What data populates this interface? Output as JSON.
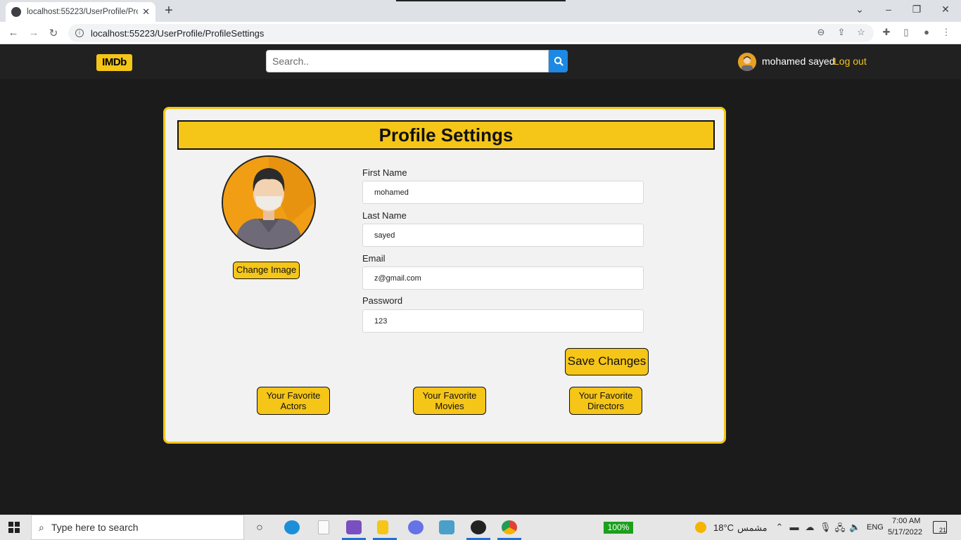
{
  "browser": {
    "tab_title": "localhost:55223/UserProfile/Profi",
    "tab_close": "✕",
    "new_tab": "+",
    "url": "localhost:55223/UserProfile/ProfileSettings"
  },
  "header": {
    "logo": "IMDb",
    "search_placeholder": "Search..",
    "username": "mohamed sayed",
    "logout": "Log out"
  },
  "profile": {
    "title": "Profile Settings",
    "change_image": "Change Image",
    "fields": {
      "first_name_label": "First Name",
      "first_name_value": "mohamed",
      "last_name_label": "Last Name",
      "last_name_value": "sayed",
      "email_label": "Email",
      "email_value": "z@gmail.com",
      "password_label": "Password",
      "password_value": "123"
    },
    "save_button": "Save Changes",
    "fav_actors": [
      "Your Favorite",
      "Actors"
    ],
    "fav_movies": [
      "Your Favorite",
      "Movies"
    ],
    "fav_directors": [
      "Your Favorite",
      "Directors"
    ]
  },
  "taskbar": {
    "search_placeholder": "Type here to search",
    "battery": "100%",
    "weather_temp": "18°C",
    "weather_text": "مشمس",
    "language": "ENG",
    "time": "7:00 AM",
    "date": "5/17/2022",
    "notification_count": "21"
  },
  "colors": {
    "brand_yellow": "#f5c518",
    "header_bg": "#212121",
    "page_bg": "#1b1b1b",
    "search_button": "#1e88e5"
  }
}
